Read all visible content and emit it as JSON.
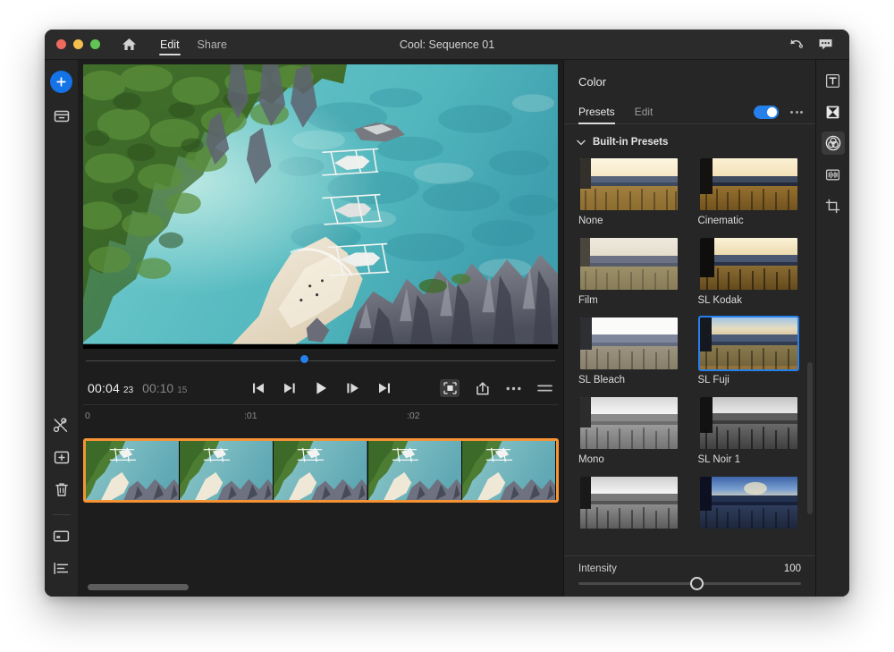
{
  "window": {
    "title": "Cool: Sequence 01",
    "traffic_lights": [
      "close",
      "minimize",
      "zoom"
    ],
    "nav_tabs": [
      {
        "label": "Edit",
        "active": true
      },
      {
        "label": "Share",
        "active": false
      }
    ],
    "title_actions": [
      {
        "name": "undo-icon",
        "label": "Undo"
      },
      {
        "name": "comment-icon",
        "label": "Comments"
      }
    ]
  },
  "left_rail": {
    "top_items": [
      {
        "name": "add-media-button",
        "icon": "plus-icon",
        "label": "Add media"
      },
      {
        "name": "media-browser-button",
        "icon": "archive-box-icon",
        "label": "Media browser"
      }
    ],
    "bottom_items": [
      {
        "name": "cut-tool-button",
        "icon": "scissors-icon",
        "label": "Cut"
      },
      {
        "name": "add-clip-button",
        "icon": "add-clip-icon",
        "label": "Add clip"
      },
      {
        "name": "delete-button",
        "icon": "trash-icon",
        "label": "Delete"
      },
      {
        "name": "card-view-button",
        "icon": "card-icon",
        "label": "Card view"
      },
      {
        "name": "properties-button",
        "icon": "list-properties-icon",
        "label": "Properties"
      }
    ]
  },
  "preview": {
    "alt": "Aerial drone shot of tropical beach with outrigger boats, turquoise water, limestone karst rocks and jungle"
  },
  "transport": {
    "current_time": "00:04",
    "current_frames": "23",
    "duration_time": "00:10",
    "duration_frames": "15",
    "buttons": [
      {
        "name": "go-to-start-button",
        "icon": "skip-to-start-icon",
        "label": "Go to start"
      },
      {
        "name": "step-back-button",
        "icon": "step-backward-icon",
        "label": "Step back"
      },
      {
        "name": "play-button",
        "icon": "play-icon",
        "label": "Play"
      },
      {
        "name": "step-forward-button",
        "icon": "step-forward-icon",
        "label": "Step forward"
      },
      {
        "name": "go-to-end-button",
        "icon": "skip-to-end-icon",
        "label": "Go to end"
      }
    ],
    "right_buttons": [
      {
        "name": "fit-to-screen-button",
        "icon": "fit-screen-icon",
        "label": "Fit to screen"
      },
      {
        "name": "export-button",
        "icon": "export-icon",
        "label": "Export"
      },
      {
        "name": "more-options-button",
        "icon": "ellipsis-icon",
        "label": "More"
      },
      {
        "name": "settings-button",
        "icon": "sliders-icon",
        "label": "Settings"
      }
    ],
    "playhead_percent": 45
  },
  "timeline": {
    "ruler_labels": [
      "0",
      ":01",
      ":02"
    ],
    "clip_selected": true,
    "selection_color": "#f59335",
    "frame_count": 5,
    "scrollbar_visible": true
  },
  "color_panel": {
    "title": "Color",
    "tabs": [
      {
        "label": "Presets",
        "active": true
      },
      {
        "label": "Edit",
        "active": false
      }
    ],
    "toggle_on": true,
    "toggle_color": "#2680eb",
    "more_label": "More options",
    "section": {
      "label": "Built-in Presets",
      "expanded": true
    },
    "presets": [
      {
        "label": "None",
        "style": "color",
        "selected": false
      },
      {
        "label": "Cinematic",
        "style": "warm",
        "selected": false
      },
      {
        "label": "Film",
        "style": "faded",
        "selected": false
      },
      {
        "label": "SL Kodak",
        "style": "kodak",
        "selected": false
      },
      {
        "label": "SL Bleach",
        "style": "bleach",
        "selected": false
      },
      {
        "label": "SL Fuji",
        "style": "fuji",
        "selected": true
      },
      {
        "label": "Mono",
        "style": "mono",
        "selected": false
      },
      {
        "label": "SL Noir 1",
        "style": "noir",
        "selected": false
      },
      {
        "label": "",
        "style": "mono2",
        "selected": false
      },
      {
        "label": "",
        "style": "blue",
        "selected": false
      }
    ],
    "intensity": {
      "label": "Intensity",
      "value": "100",
      "min": 0,
      "max": 100
    }
  },
  "right_rail": {
    "items": [
      {
        "name": "text-tool-button",
        "icon": "text-icon",
        "label": "Text",
        "active": false
      },
      {
        "name": "transitions-tool-button",
        "icon": "transitions-icon",
        "label": "Transitions",
        "active": false
      },
      {
        "name": "color-tool-button",
        "icon": "color-wheel-icon",
        "label": "Color",
        "active": true
      },
      {
        "name": "audio-tool-button",
        "icon": "audio-icon",
        "label": "Audio",
        "active": false
      },
      {
        "name": "crop-tool-button",
        "icon": "crop-icon",
        "label": "Crop",
        "active": false
      }
    ]
  }
}
